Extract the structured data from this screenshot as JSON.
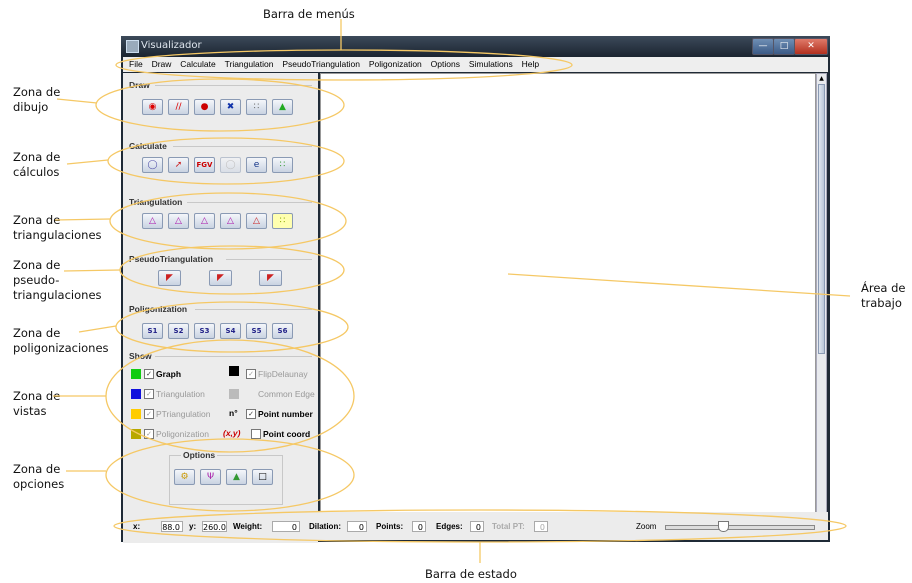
{
  "annotations": {
    "menubar_label": "Barra de menús",
    "statusbar_label": "Barra de estado",
    "draw_zone": "Zona de\ndibujo",
    "calc_zone": "Zona de\ncálculos",
    "tri_zone": "Zona de\ntriangulaciones",
    "ptri_zone": "Zona de\npseudo-\ntriangulaciones",
    "poly_zone": "Zona de\npoligonizaciones",
    "views_zone": "Zona de\nvistas",
    "options_zone": "Zona de\nopciones",
    "work_area": "Área de\ntrabajo"
  },
  "window": {
    "title": "Visualizador"
  },
  "menu": [
    "File",
    "Draw",
    "Calculate",
    "Triangulation",
    "PseudoTriangulation",
    "Poligonization",
    "Options",
    "Simulations",
    "Help"
  ],
  "sections": {
    "draw": "Draw",
    "calculate": "Calculate",
    "triangulation": "Triangulation",
    "pseudotriangulation": "PseudoTriangulation",
    "poligonization": "Poligonization",
    "show": "Show",
    "options": "Options"
  },
  "calc_buttons": {
    "fgv": "FGV"
  },
  "poly_buttons": [
    "S1",
    "S2",
    "S3",
    "S4",
    "S5",
    "S6"
  ],
  "show": {
    "graph": "Graph",
    "triangulation": "Triangulation",
    "ptriangulation": "PTriangulation",
    "poligonization": "Poligonization",
    "flipdelaunay": "FlipDelaunay",
    "common_edge": "Common Edge",
    "point_number": "Point number",
    "point_coord": "Point coord",
    "pn_glyph": "n°",
    "pc_glyph": "(x,y)"
  },
  "colors": {
    "graph": "#11cc11",
    "triangulation": "#1111dd",
    "ptriangulation": "#ffcc00",
    "poligonization": "#b8a800",
    "flipdelaunay": "#000000",
    "common_edge": "#bbbbbb"
  },
  "status": {
    "x_label": "x:",
    "x_value": "88.0",
    "y_label": "y:",
    "y_value": "260.0",
    "weight_label": "Weight:",
    "weight_value": "0",
    "dilation_label": "Dilation:",
    "dilation_value": "0",
    "points_label": "Points:",
    "points_value": "0",
    "edges_label": "Edges:",
    "edges_value": "0",
    "totalpt_label": "Total PT:",
    "totalpt_value": "0",
    "zoom_label": "Zoom"
  }
}
